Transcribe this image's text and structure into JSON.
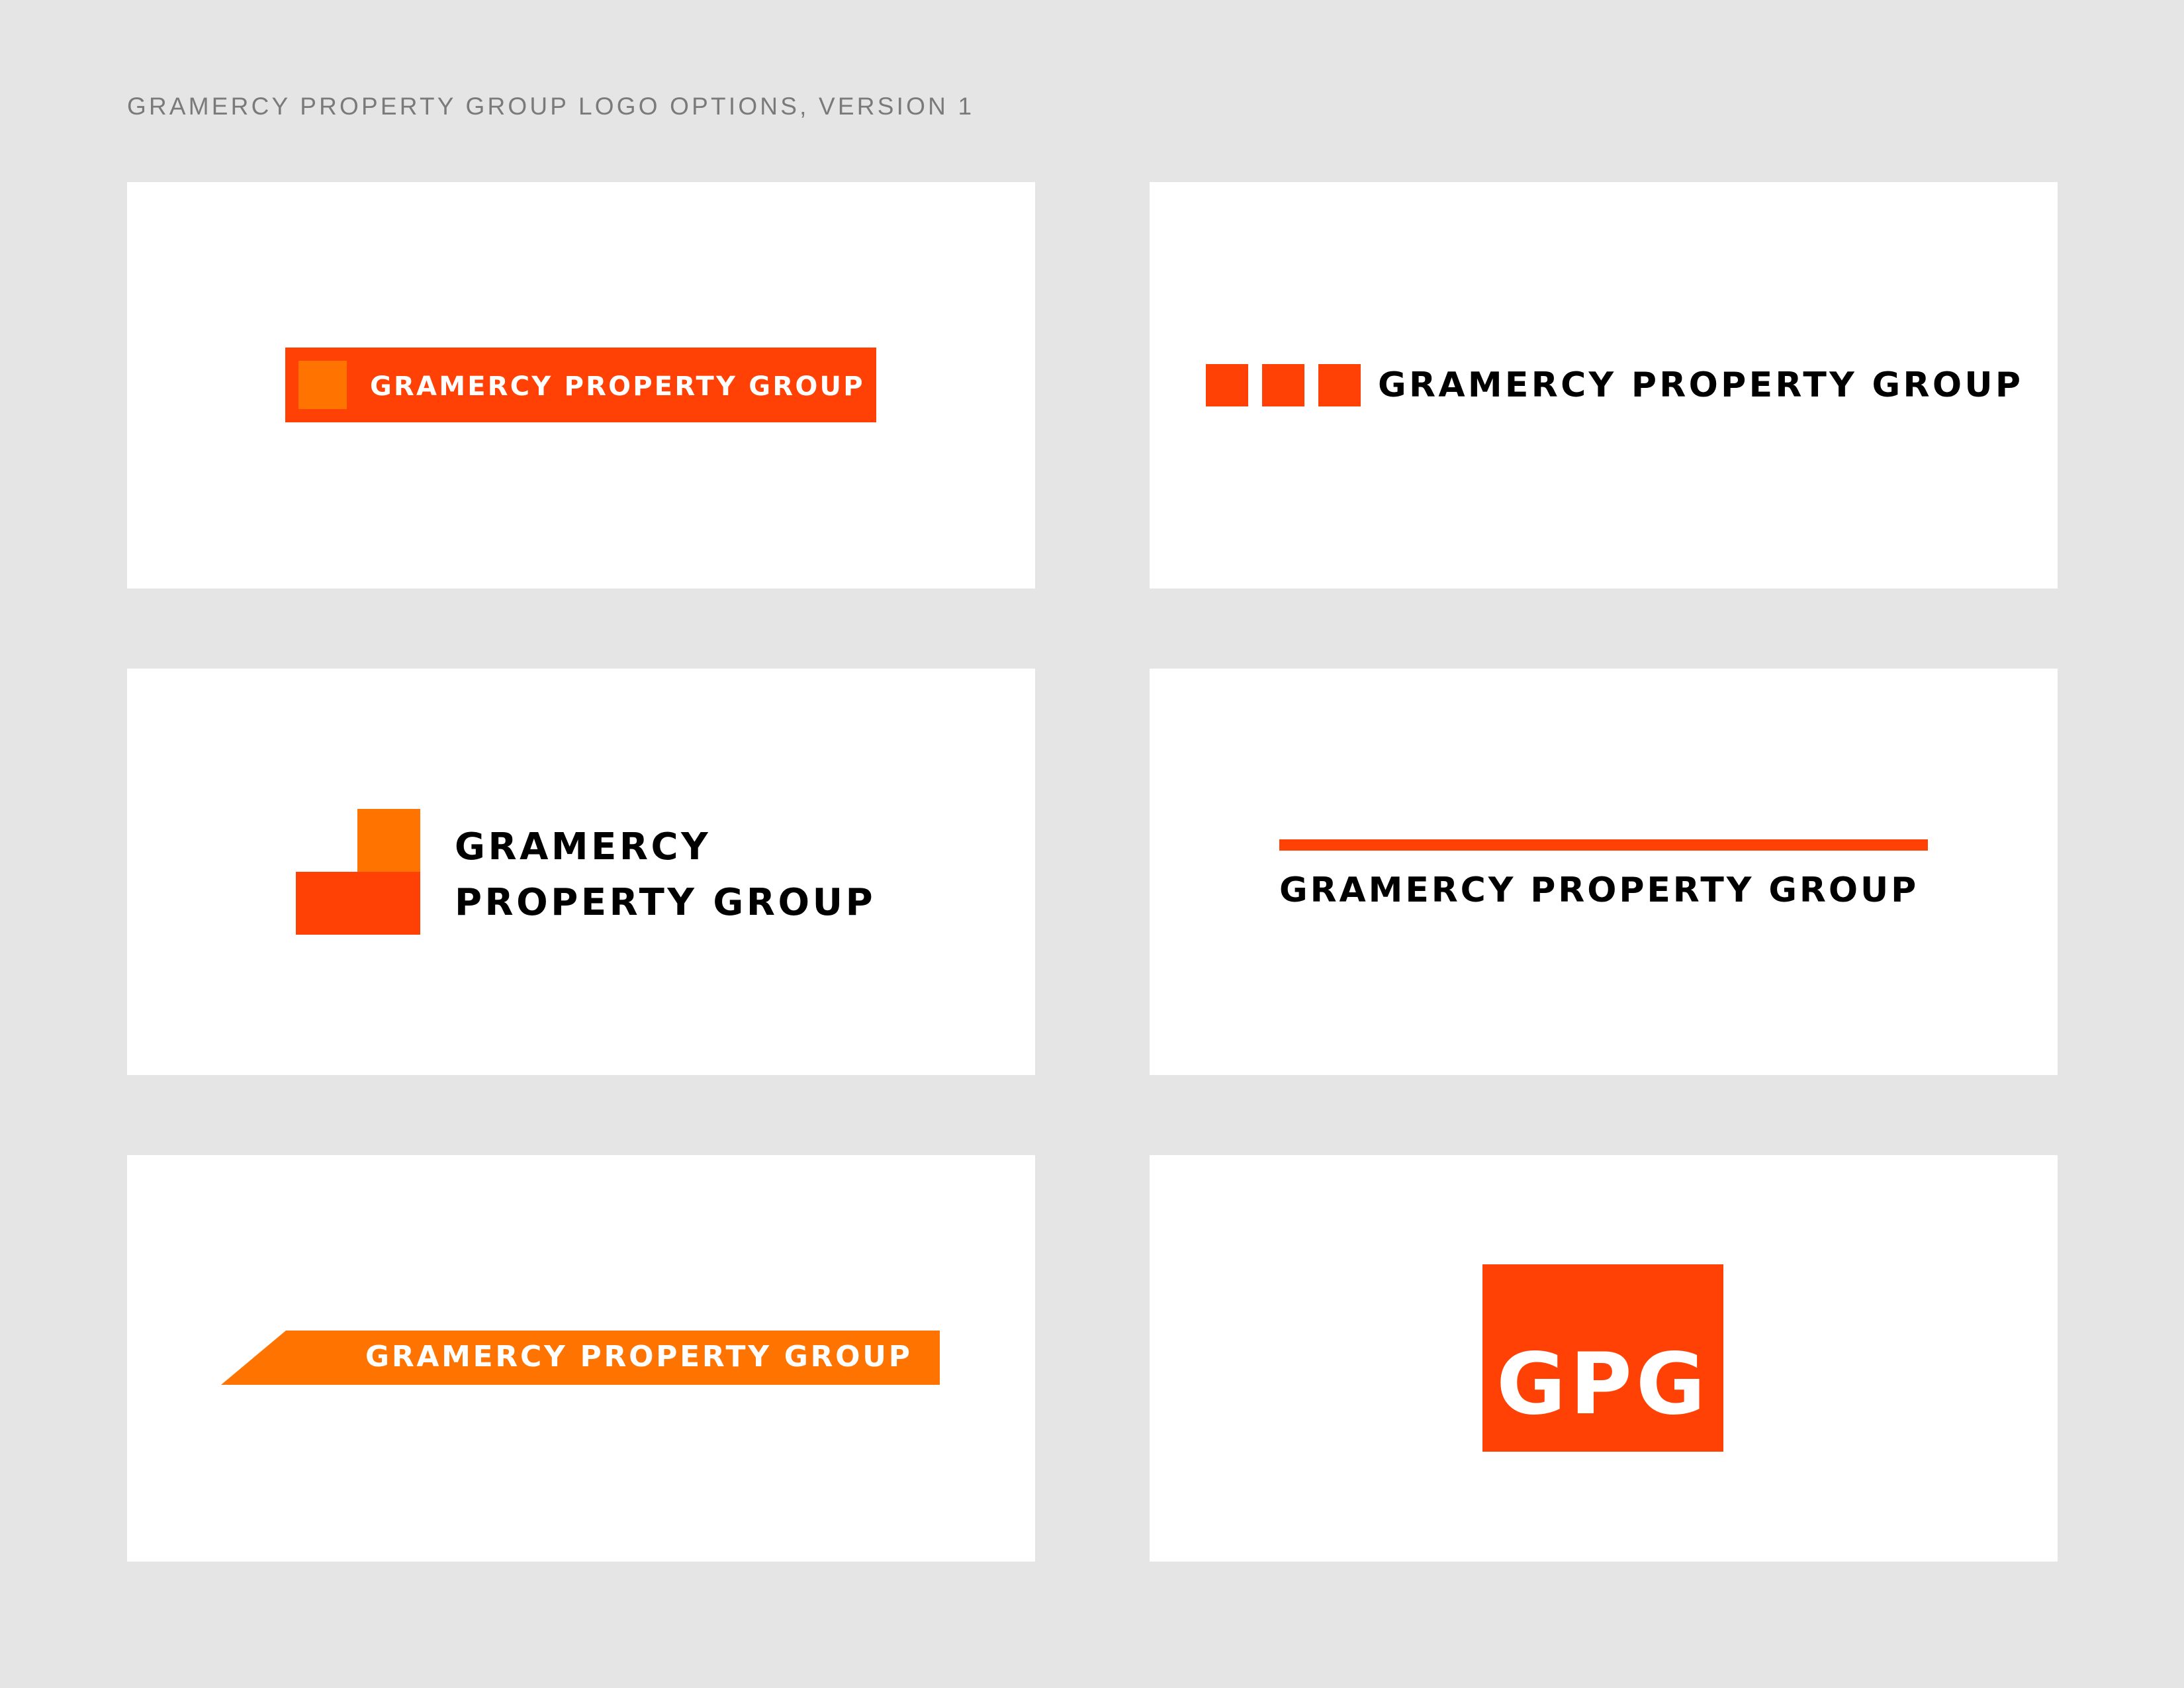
{
  "page": {
    "title": "GRAMERCY PROPERTY GROUP LOGO OPTIONS, VERSION 1",
    "background": "#e5e5e5"
  },
  "colors": {
    "orange_red": "#ff4105",
    "orange": "#ff7300",
    "black": "#000000",
    "white": "#ffffff"
  },
  "logos": [
    {
      "option": 1,
      "style": "orange-red bar with orange square and white wordmark",
      "wordmark": "GRAMERCY PROPERTY GROUP"
    },
    {
      "option": 2,
      "style": "three orange-red squares with black wordmark",
      "wordmark": "GRAMERCY PROPERTY GROUP"
    },
    {
      "option": 3,
      "style": "stacked orange blocks with two-line black wordmark",
      "wordmark_line1": "GRAMERCY",
      "wordmark_line2": "PROPERTY GROUP"
    },
    {
      "option": 4,
      "style": "orange-red rule above black wordmark",
      "wordmark": "GRAMERCY PROPERTY GROUP"
    },
    {
      "option": 5,
      "style": "slanted orange banner with white wordmark",
      "wordmark": "GRAMERCY PROPERTY GROUP"
    },
    {
      "option": 6,
      "style": "orange-red box monogram",
      "monogram": "GPG"
    }
  ]
}
